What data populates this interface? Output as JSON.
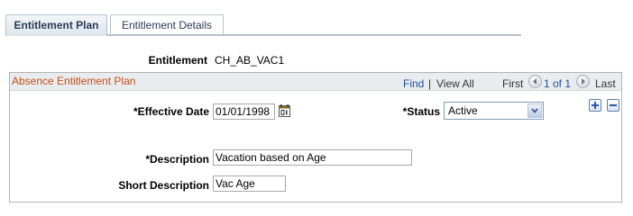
{
  "tabs": [
    {
      "label": "Entitlement Plan",
      "active": true
    },
    {
      "label": "Entitlement Details",
      "active": false
    }
  ],
  "entitlement": {
    "label": "Entitlement",
    "value": "CH_AB_VAC1"
  },
  "group": {
    "title": "Absence Entitlement Plan",
    "find": "Find",
    "separator": "|",
    "view_all": "View All",
    "first": "First",
    "count": "1 of 1",
    "last": "Last"
  },
  "form": {
    "effective_date_label": "*Effective Date",
    "effective_date_value": "01/01/1998",
    "status_label": "*Status",
    "status_value": "Active",
    "description_label": "*Description",
    "description_value": "Vacation based on Age",
    "short_description_label": "Short Description",
    "short_description_value": "Vac Age"
  },
  "colors": {
    "group_title": "#c24f17",
    "link": "#1f4f96",
    "tab_border": "#b5c2cf"
  },
  "icons": {
    "calendar": "calendar-icon",
    "add_row": "add-row-icon",
    "delete_row": "delete-row-icon",
    "prev": "previous-arrow-icon",
    "next": "next-arrow-icon",
    "dropdown": "chevron-down-icon"
  }
}
